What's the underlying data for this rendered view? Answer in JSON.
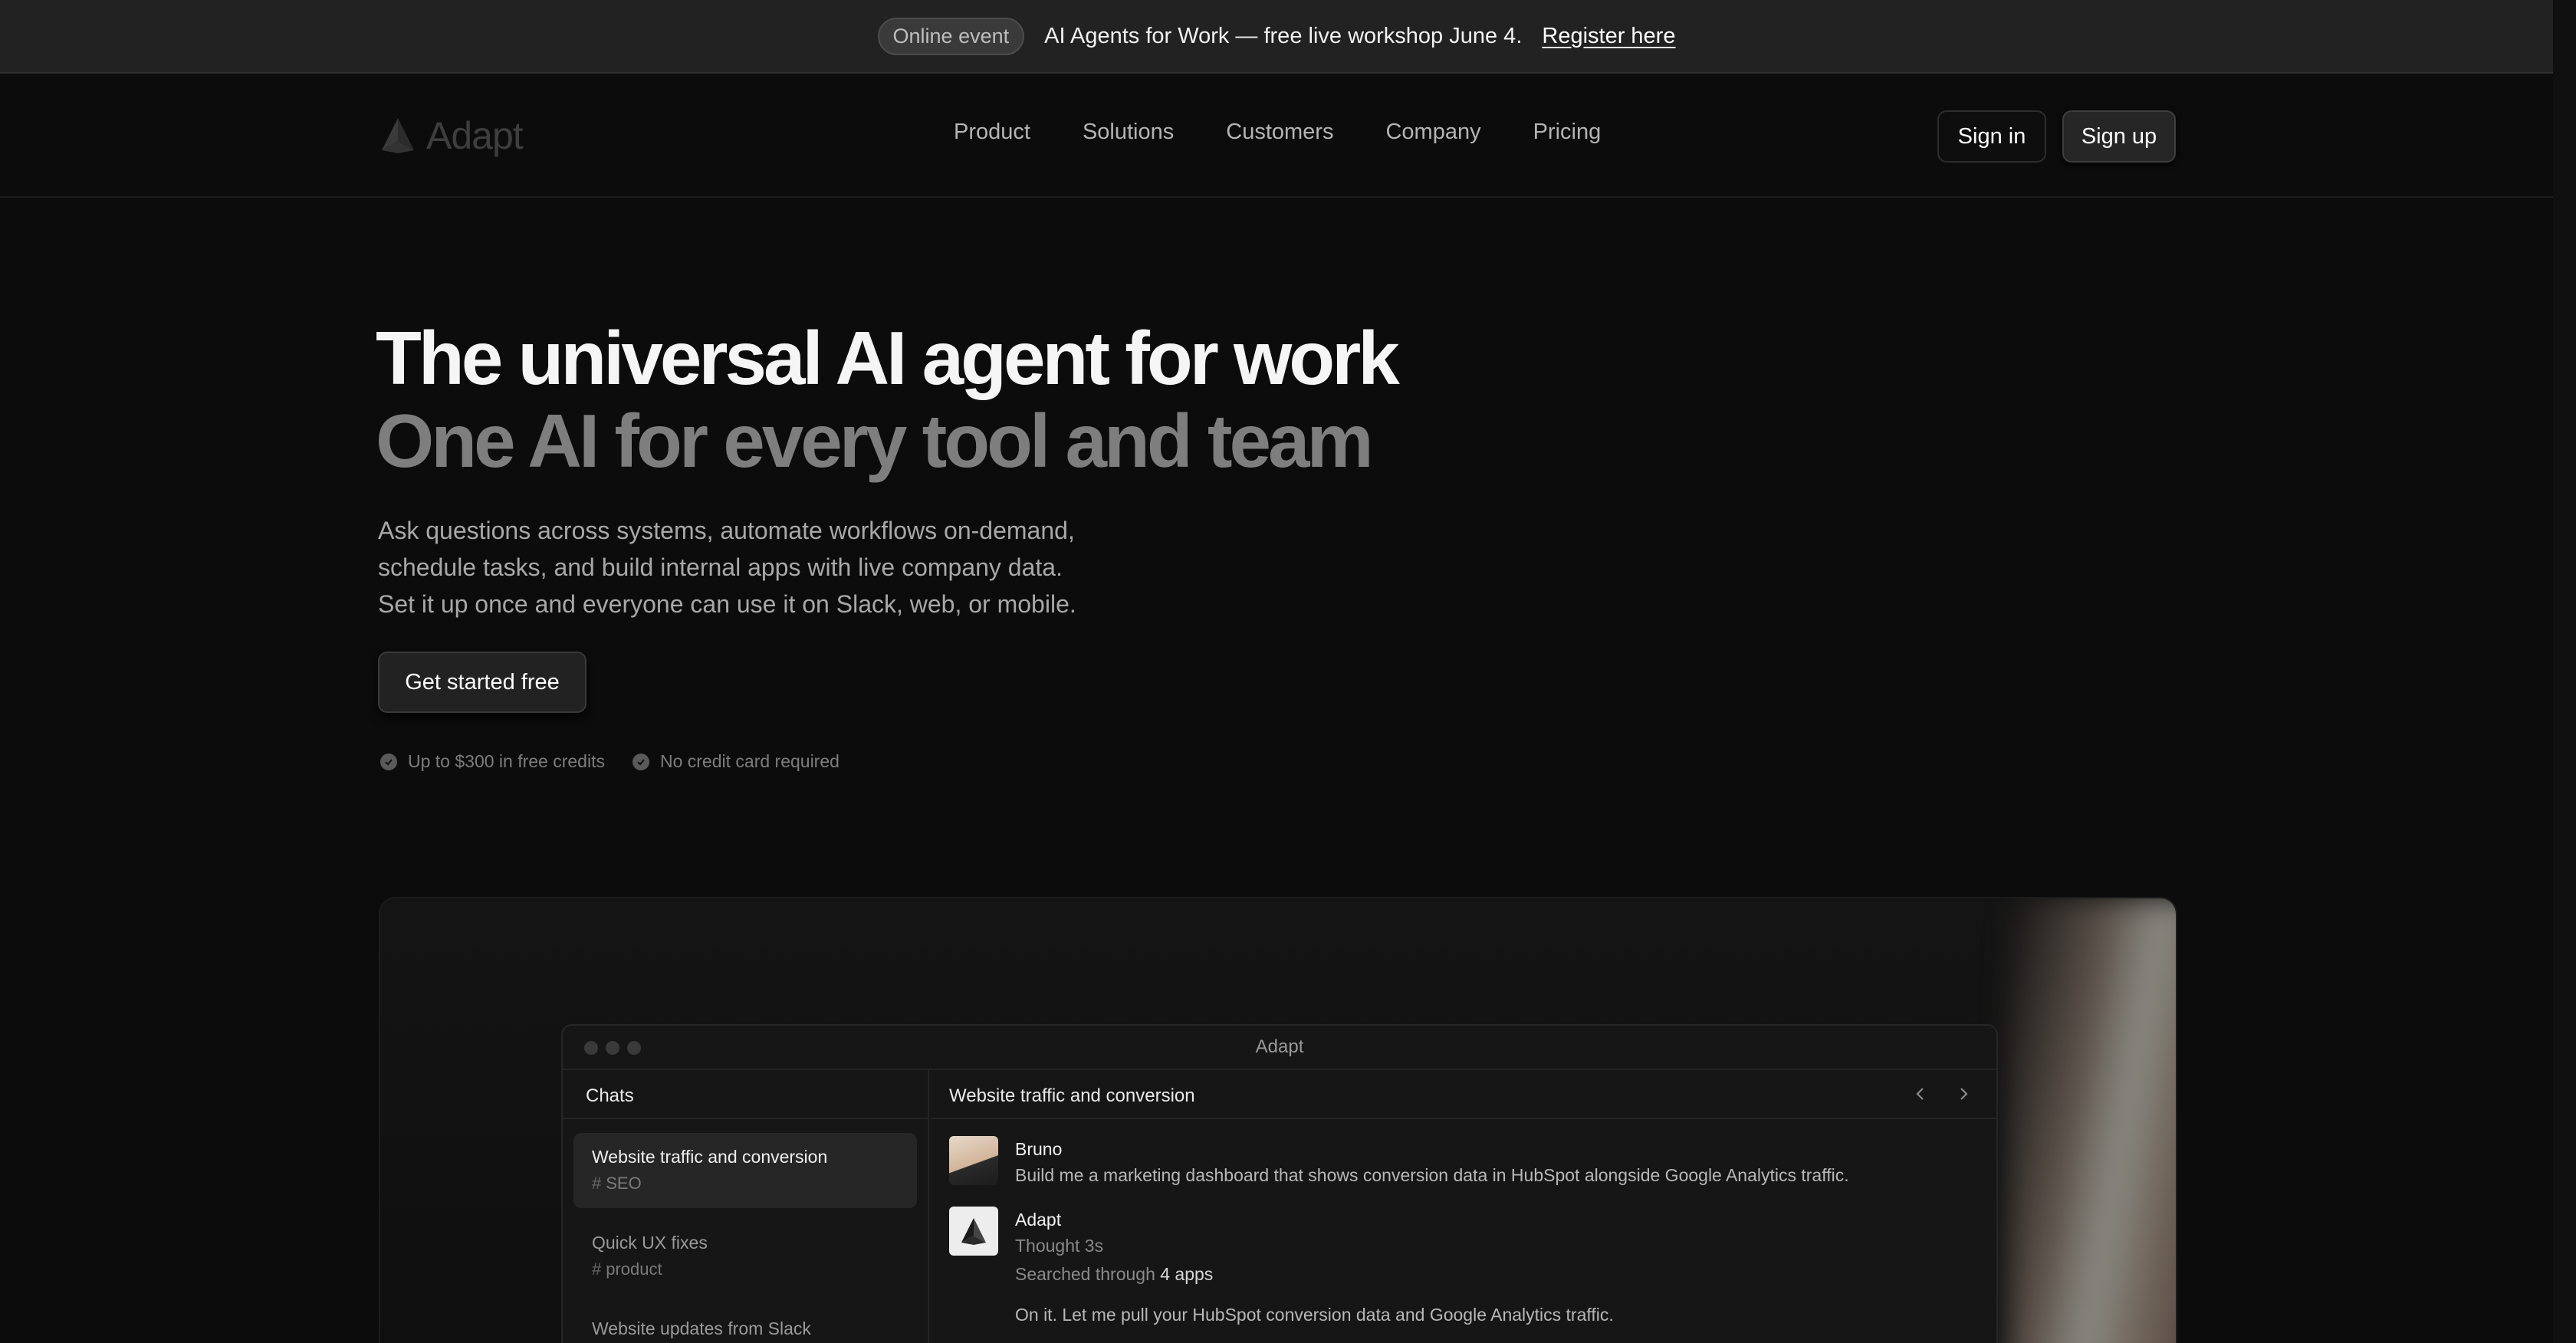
{
  "announcement": {
    "badge": "Online event",
    "text": "AI Agents for Work — free live workshop June 4.",
    "link": "Register here"
  },
  "header": {
    "logo_text": "Adapt",
    "nav": [
      "Product",
      "Solutions",
      "Customers",
      "Company",
      "Pricing"
    ],
    "signin": "Sign in",
    "signup": "Sign up"
  },
  "hero": {
    "title": "The universal AI agent for work",
    "subtitle": "One AI for every tool and team",
    "description_lines": [
      "Ask questions across systems, automate workflows on-demand,",
      "schedule tasks, and build internal apps with live company data.",
      "Set it up once and everyone can use it on Slack, web, or mobile."
    ],
    "cta": "Get started free",
    "perks": [
      "Up to $300 in free credits",
      "No credit card required"
    ]
  },
  "app": {
    "window_title": "Adapt",
    "sidebar_title": "Chats",
    "chats": [
      {
        "title": "Website traffic and conversion",
        "tag": "SEO",
        "active": true
      },
      {
        "title": "Quick UX fixes",
        "tag": "product",
        "active": false
      },
      {
        "title": "Website updates from Slack",
        "tag": "",
        "active": false
      }
    ],
    "conversation_title": "Website traffic and conversion",
    "messages": [
      {
        "author": "Bruno",
        "text": "Build me a marketing dashboard that shows conversion data in HubSpot alongside Google Analytics traffic."
      },
      {
        "author": "Adapt",
        "thought": "Thought 3s",
        "searched_prefix": "Searched through",
        "searched_count": "4 apps",
        "reply": "On it. Let me pull your HubSpot conversion data and Google Analytics traffic."
      }
    ]
  },
  "icons": {
    "logo": "adapt-logo-icon",
    "check": "check-circle-icon",
    "prev": "chevron-left-icon",
    "next": "chevron-right-icon"
  }
}
